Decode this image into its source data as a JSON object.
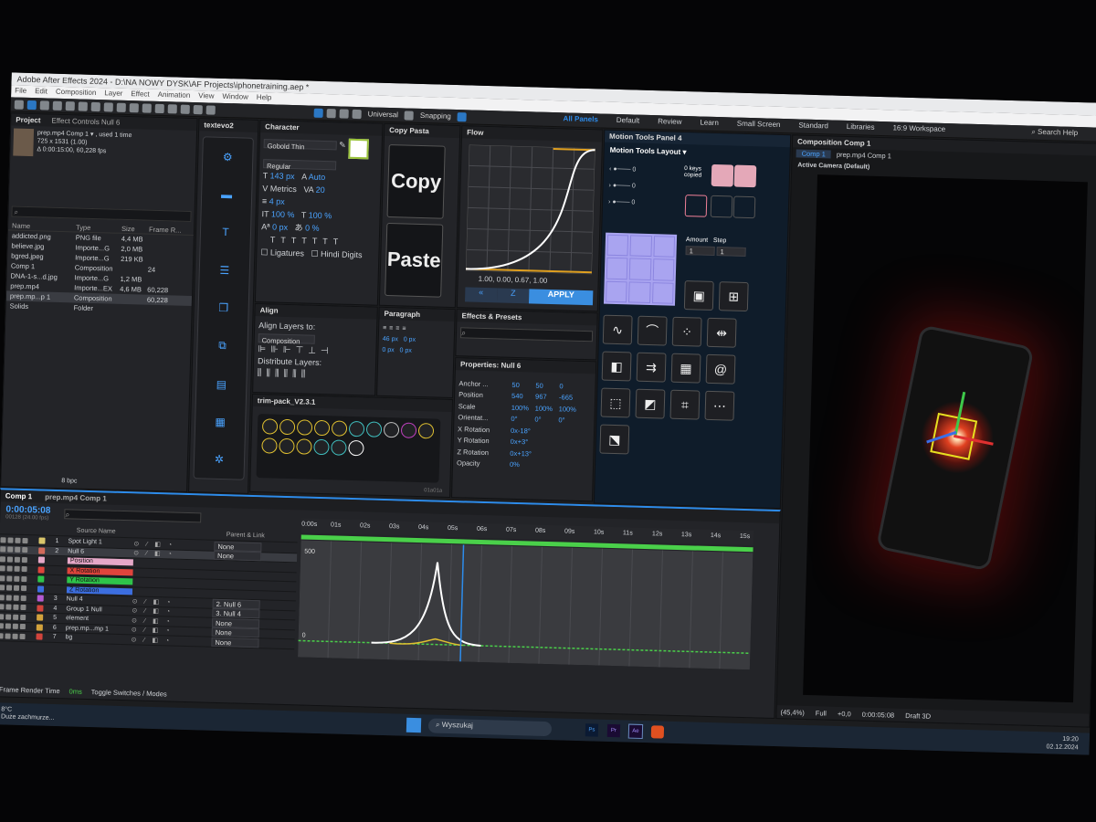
{
  "title": "Adobe After Effects 2024 - D:\\NA NOWY DYSK\\AF Projects\\iphonetraining.aep *",
  "menu": [
    "File",
    "Edit",
    "Composition",
    "Layer",
    "Effect",
    "Animation",
    "View",
    "Window",
    "Help"
  ],
  "toolbar": {
    "universal": "Universal",
    "snapping": "Snapping"
  },
  "workspaces": [
    "All Panels",
    "Default",
    "Review",
    "Learn",
    "Small Screen",
    "Standard",
    "Libraries",
    "16:9 Workspace"
  ],
  "search_help": "Search Help",
  "project": {
    "tab": "Project",
    "effect_controls": "Effect Controls Null 6",
    "item_name": "prep.mp4 Comp 1 ▾ , used 1 time",
    "item_size": "725 x 1531 (1.00)",
    "item_duration": "Δ 0:00:15:00, 60,228 fps",
    "headers": {
      "name": "Name",
      "type": "Type",
      "size": "Size",
      "fps": "Frame R..."
    },
    "rows": [
      {
        "name": "addicted.png",
        "type": "PNG file",
        "size": "4,4 MB",
        "fps": ""
      },
      {
        "name": "believe.jpg",
        "type": "Importe...G",
        "size": "2,0 MB",
        "fps": ""
      },
      {
        "name": "bgred.jpeg",
        "type": "Importe...G",
        "size": "219 KB",
        "fps": ""
      },
      {
        "name": "Comp 1",
        "type": "Composition",
        "size": "",
        "fps": "24"
      },
      {
        "name": "DNA-1-s...d.jpg",
        "type": "Importe...G",
        "size": "1,2 MB",
        "fps": ""
      },
      {
        "name": "prep.mp4",
        "type": "Importe...EX",
        "size": "4,6 MB",
        "fps": "60,228"
      },
      {
        "name": "prep.mp...p 1",
        "type": "Composition",
        "size": "",
        "fps": "60,228"
      },
      {
        "name": "Solids",
        "type": "Folder",
        "size": "",
        "fps": ""
      }
    ],
    "bpc": "8 bpc"
  },
  "textevo": {
    "tab": "textevo2"
  },
  "character": {
    "tab": "Character",
    "font": "Gobold Thin",
    "style": "Regular",
    "size": "143 px",
    "leading": "Auto",
    "kerning": "Metrics",
    "tracking": "20",
    "stroke": "4 px",
    "vscale": "100 %",
    "hscale": "100 %",
    "baseline": "0 px",
    "tsume": "0 %",
    "ligatures": "Ligatures",
    "hindi": "Hindi Digits"
  },
  "copypasta": {
    "tab": "Copy Pasta",
    "copy": "Copy",
    "paste": "Paste"
  },
  "flow": {
    "tab": "Flow",
    "values": "1.00, 0.00, 0.67, 1.00",
    "apply": "APPLY"
  },
  "motion_tools": {
    "tab": "Motion Tools Panel 4",
    "layout": "Motion Tools Layout ▾",
    "keys_copied": "0 keys copied",
    "amount": "Amount",
    "step": "Step",
    "amount_val": "1",
    "step_val": "1",
    "slider_vals": [
      "0",
      "0",
      "0"
    ]
  },
  "align": {
    "tab": "Align",
    "align_to_label": "Align Layers to:",
    "align_to": "Composition",
    "distribute": "Distribute Layers:"
  },
  "paragraph": {
    "tab": "Paragraph",
    "indent1": "46 px",
    "indent2": "0 px",
    "v1": "0 px",
    "v2": "0 px",
    "v3": "0 px",
    "v4": "0 px"
  },
  "effects": {
    "tab": "Effects & Presets"
  },
  "trimpack": {
    "tab": "trim-pack_V2.3.1",
    "code": "01a01a"
  },
  "properties": {
    "tab": "Properties: Null 6",
    "rows": [
      {
        "name": "Anchor ...",
        "v": [
          "50",
          "50",
          "0"
        ]
      },
      {
        "name": "Position",
        "v": [
          "540",
          "967",
          "-665"
        ]
      },
      {
        "name": "Scale",
        "v": [
          "100%",
          "100%",
          "100%"
        ]
      },
      {
        "name": "Orientat...",
        "v": [
          "0°",
          "0°",
          "0°"
        ]
      },
      {
        "name": "X Rotation",
        "v": [
          "0x-18°",
          "",
          ""
        ]
      },
      {
        "name": "Y Rotation",
        "v": [
          "0x+3°",
          "",
          ""
        ]
      },
      {
        "name": "Z Rotation",
        "v": [
          "0x+13°",
          "",
          ""
        ]
      },
      {
        "name": "Opacity",
        "v": [
          "0%",
          "",
          ""
        ]
      }
    ]
  },
  "composition": {
    "tab": "Composition Comp 1",
    "subtab": "Comp 1",
    "breadcrumb": "prep.mp4 Comp 1",
    "camera": "Active Camera (Default)",
    "zoom": "(45,4%)",
    "quality": "Full",
    "timecode": "0:00:05:08",
    "draft": "Draft 3D",
    "offset": "+0,0"
  },
  "timeline": {
    "tabs": [
      "Comp 1",
      "prep.mp4 Comp 1"
    ],
    "timecode": "0:00:05:08",
    "fps": "00128 (24.00 fps)",
    "headers": {
      "source": "Source Name",
      "parent": "Parent & Link"
    },
    "layers": [
      {
        "num": "1",
        "name": "Spot Light 1",
        "parent": "None",
        "color": "#d9c56a"
      },
      {
        "num": "2",
        "name": "Null 6",
        "parent": "None",
        "color": "#d26a5a",
        "selected": true
      },
      {
        "num": "",
        "name": "Position",
        "parent": "",
        "color": "#e6a8c8",
        "prop": true
      },
      {
        "num": "",
        "name": "X Rotation",
        "parent": "",
        "color": "#e0443c",
        "prop": true
      },
      {
        "num": "",
        "name": "Y Rotation",
        "parent": "",
        "color": "#2ec44a",
        "prop": true
      },
      {
        "num": "",
        "name": "Z Rotation",
        "parent": "",
        "color": "#3c6ee0",
        "prop": true
      },
      {
        "num": "3",
        "name": "Null 4",
        "parent": "2. Null 6",
        "color": "#b55ad2"
      },
      {
        "num": "4",
        "name": "Group 1 Null",
        "parent": "3. Null 4",
        "color": "#d2443c"
      },
      {
        "num": "5",
        "name": "element",
        "parent": "None",
        "color": "#d2a23c"
      },
      {
        "num": "6",
        "name": "prep.mp...mp 1",
        "parent": "None",
        "color": "#d2a23c"
      },
      {
        "num": "7",
        "name": "bg",
        "parent": "None",
        "color": "#d2443c"
      }
    ],
    "ticks": [
      "0:00s",
      "01s",
      "02s",
      "03s",
      "04s",
      "05s",
      "06s",
      "07s",
      "08s",
      "09s",
      "10s",
      "11s",
      "12s",
      "13s",
      "14s",
      "15s"
    ],
    "graph_label": "500",
    "graph_zero": "0",
    "frame_render": "Frame Render Time",
    "render_ms": "0ms",
    "toggle": "Toggle Switches / Modes"
  },
  "taskbar": {
    "temp": "8°C",
    "weather": "Duże zachmurze...",
    "search": "Wyszukaj",
    "time": "19:20",
    "date": "02.12.2024"
  }
}
